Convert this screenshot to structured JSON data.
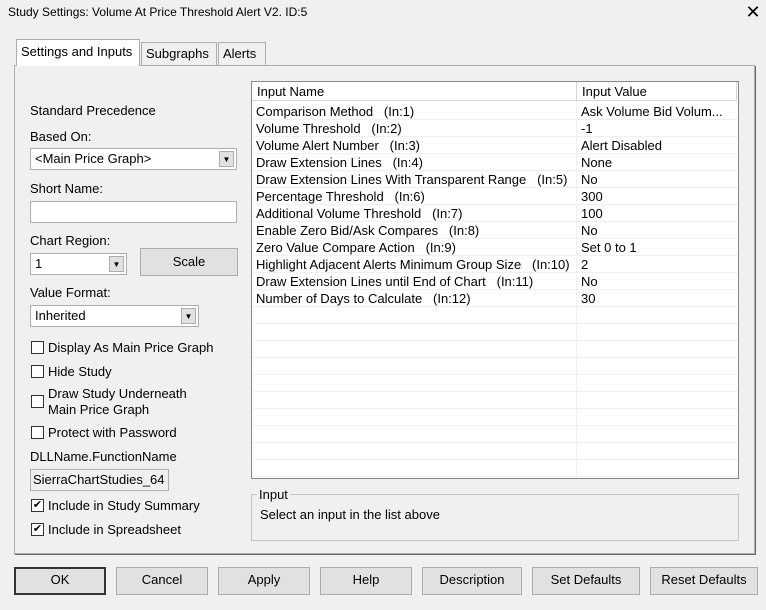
{
  "window": {
    "title": "Study Settings: Volume At Price Threshold Alert V2. ID:5",
    "close": "✕"
  },
  "tabs": [
    {
      "label": "Settings and Inputs"
    },
    {
      "label": "Subgraphs"
    },
    {
      "label": "Alerts"
    }
  ],
  "left": {
    "standard_precedence": "Standard Precedence",
    "based_on_label": "Based On:",
    "based_on_value": "<Main Price Graph>",
    "short_name_label": "Short Name:",
    "short_name_value": "",
    "chart_region_label": "Chart Region:",
    "chart_region_value": "1",
    "scale_button": "Scale",
    "value_format_label": "Value Format:",
    "value_format_value": "Inherited",
    "checkboxes": [
      {
        "label": "Display As Main Price Graph",
        "checked": false
      },
      {
        "label": "Hide Study",
        "checked": false
      },
      {
        "label": "Draw Study Underneath",
        "label2": "Main Price Graph",
        "checked": false
      },
      {
        "label": "Protect with Password",
        "checked": false
      }
    ],
    "dll_label": "DLLName.FunctionName",
    "dll_value": "SierraChartStudies_64",
    "checkboxes2": [
      {
        "label": "Include in Study Summary",
        "checked": true
      },
      {
        "label": "Include in Spreadsheet",
        "checked": true
      }
    ]
  },
  "grid": {
    "headers": [
      "Input Name",
      "Input Value"
    ],
    "rows": [
      [
        "Comparison Method   (In:1)",
        "Ask Volume Bid Volum..."
      ],
      [
        "Volume Threshold   (In:2)",
        "-1"
      ],
      [
        "Volume Alert Number   (In:3)",
        "Alert Disabled"
      ],
      [
        "Draw Extension Lines   (In:4)",
        "None"
      ],
      [
        "Draw Extension Lines With Transparent Range   (In:5)",
        "No"
      ],
      [
        "Percentage Threshold   (In:6)",
        "300"
      ],
      [
        "Additional Volume Threshold   (In:7)",
        "100"
      ],
      [
        "Enable Zero Bid/Ask Compares   (In:8)",
        "No"
      ],
      [
        "Zero Value Compare Action   (In:9)",
        "Set 0 to 1"
      ],
      [
        "Highlight Adjacent Alerts Minimum Group Size   (In:10)",
        "2"
      ],
      [
        "Draw Extension Lines until End of Chart   (In:11)",
        "No"
      ],
      [
        "Number of Days to Calculate   (In:12)",
        "30"
      ]
    ]
  },
  "input_group": {
    "label": "Input",
    "text": "Select an input in the list above"
  },
  "buttons": [
    "OK",
    "Cancel",
    "Apply",
    "Help",
    "Description",
    "Set Defaults",
    "Reset Defaults"
  ]
}
